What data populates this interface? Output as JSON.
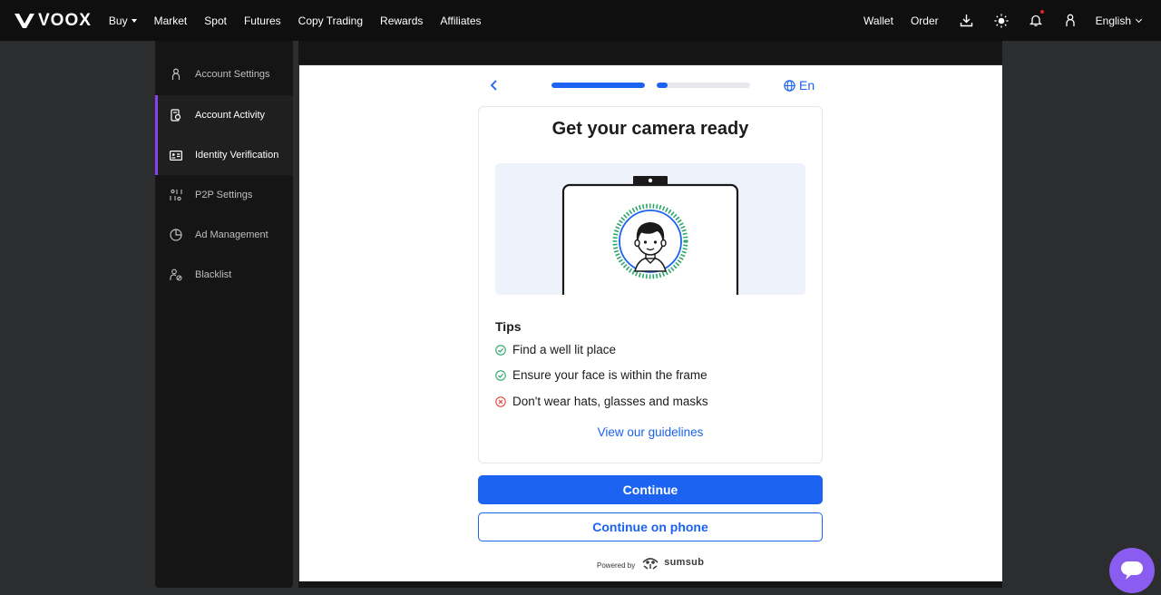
{
  "brand": {
    "name": "VOOX"
  },
  "nav": {
    "items": [
      {
        "label": "Buy",
        "has_caret": true
      },
      {
        "label": "Market"
      },
      {
        "label": "Spot"
      },
      {
        "label": "Futures"
      },
      {
        "label": "Copy Trading"
      },
      {
        "label": "Rewards"
      },
      {
        "label": "Affiliates"
      }
    ],
    "right": {
      "wallet": "Wallet",
      "order": "Order",
      "icons": [
        "download-icon",
        "theme-sun-icon",
        "bell-icon",
        "user-icon"
      ],
      "language": "English"
    }
  },
  "sidebar": {
    "items": [
      {
        "label": "Account Settings",
        "icon": "user-icon",
        "active": false
      },
      {
        "label": "Account Activity",
        "icon": "activity-icon",
        "active": true
      },
      {
        "label": "Identity Verification",
        "icon": "id-card-icon",
        "active": true
      },
      {
        "label": "P2P Settings",
        "icon": "p2p-icon",
        "active": false
      },
      {
        "label": "Ad Management",
        "icon": "pie-chart-icon",
        "active": false
      },
      {
        "label": "Blacklist",
        "icon": "user-block-icon",
        "active": false
      }
    ]
  },
  "verification": {
    "progress": {
      "step1_fraction": 1.0,
      "step2_fraction": 0.12
    },
    "language_label": "En",
    "title": "Get your camera ready",
    "tips_title": "Tips",
    "tips": [
      {
        "text": "Find a well lit place",
        "status": "ok"
      },
      {
        "text": "Ensure your face is within the frame",
        "status": "ok"
      },
      {
        "text": "Don't wear hats, glasses and masks",
        "status": "bad"
      }
    ],
    "guidelines_link": "View our guidelines",
    "continue_label": "Continue",
    "continue_phone_label": "Continue on phone",
    "powered_by": "Powered by",
    "provider": "sumsub"
  },
  "colors": {
    "accent": "#1b63f0",
    "sidebar_active": "#8a3ff0",
    "ok": "#2ca56a",
    "bad": "#e0483a",
    "chat_fab": "#8a5cf0"
  }
}
